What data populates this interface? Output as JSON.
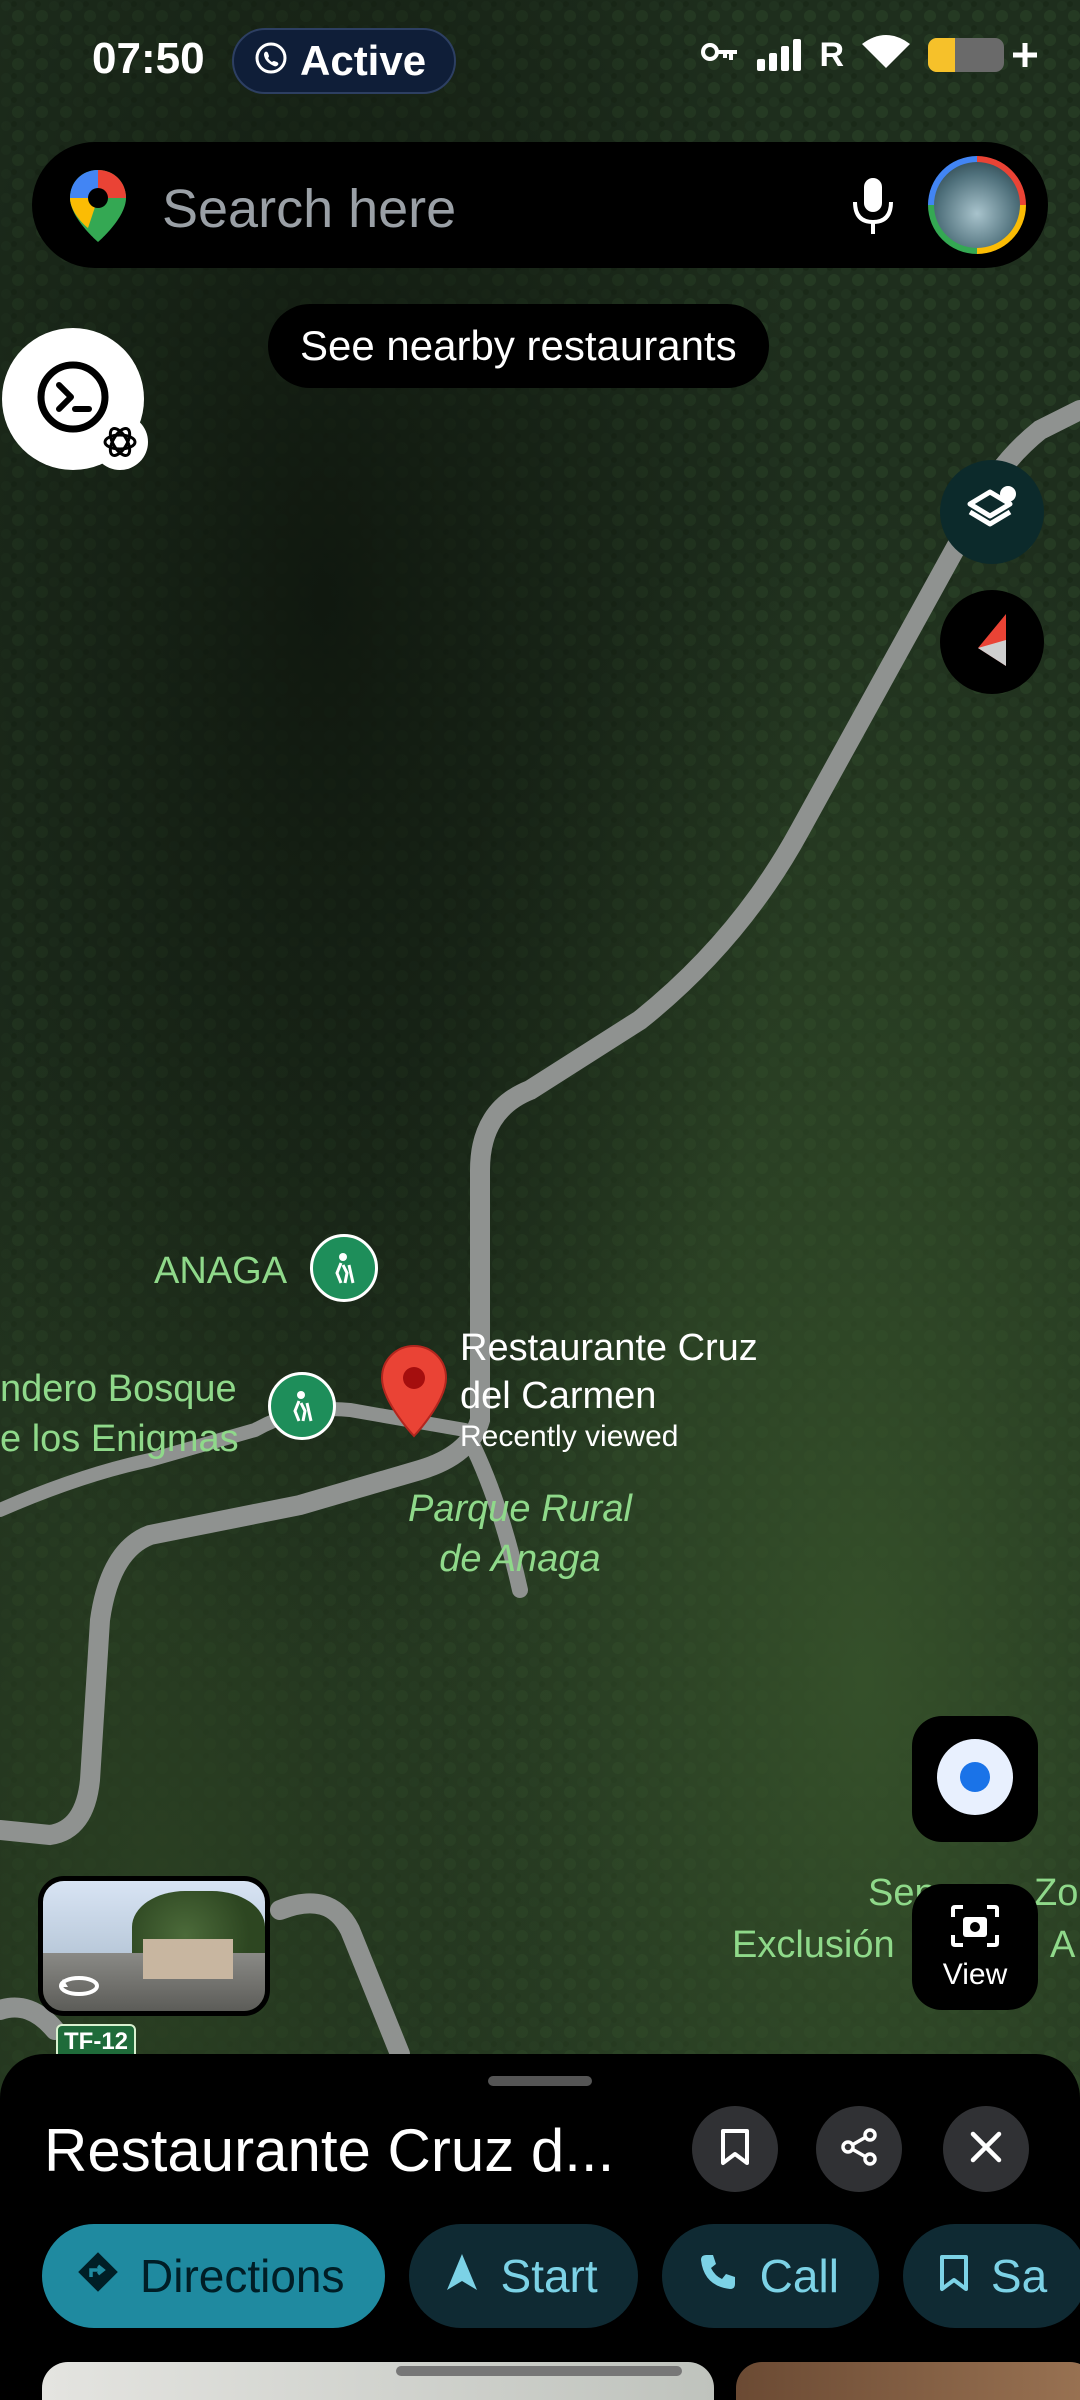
{
  "status_bar": {
    "time": "07:50",
    "active_label": "Active",
    "signal_label": "R",
    "battery_level": 0.35,
    "icons": [
      "key-icon",
      "signal-icon",
      "wifi-icon",
      "battery-icon"
    ]
  },
  "search": {
    "placeholder": "Search here"
  },
  "chip": {
    "label": "See nearby restaurants"
  },
  "map": {
    "labels": {
      "anaga": "ANAGA",
      "sendero_line1": "ndero Bosque",
      "sendero_line2": "e los Enigmas",
      "parque_line1": "Parque Rural",
      "parque_line2": "de Anaga",
      "right_top": "Sen",
      "right_top2": "Zo",
      "right_bottom": "Exclusión",
      "right_bottom2": "A",
      "road_shield": "TF-12"
    },
    "selected_place": {
      "line1": "Restaurante Cruz",
      "line2": "del Carmen",
      "sub": "Recently viewed"
    }
  },
  "controls": {
    "view_label": "View"
  },
  "sheet": {
    "title": "Restaurante Cruz d...",
    "actions": [
      "Directions",
      "Start",
      "Call",
      "Sa"
    ]
  },
  "colors": {
    "map_forest": "#1b2a1c",
    "road": "#8f9290",
    "pin": "#ea4335",
    "poi_green": "#1e8e5a",
    "label_green": "#8fd98a",
    "primary_button": "#1f8aa0",
    "secondary_button": "#0f2a33",
    "accent_text": "#7cd2e6"
  }
}
